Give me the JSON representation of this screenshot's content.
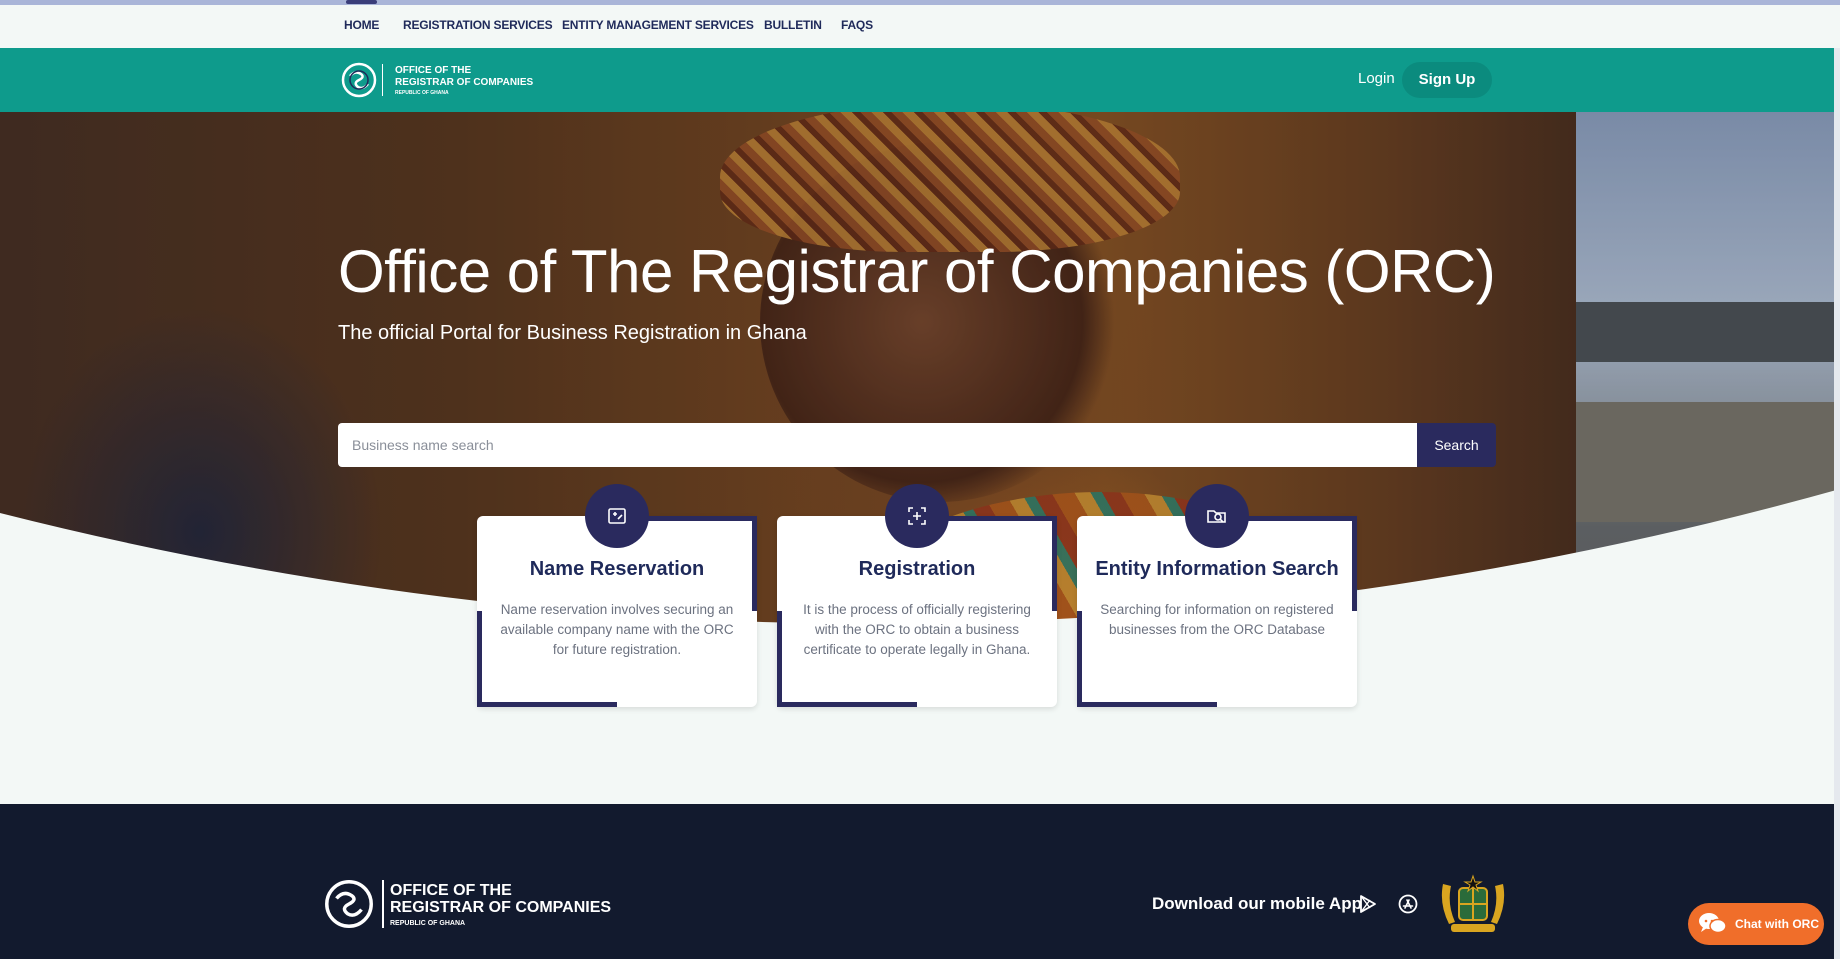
{
  "top_nav": {
    "items": [
      {
        "label": "HOME",
        "active": true
      },
      {
        "label": "REGISTRATION SERVICES"
      },
      {
        "label": "ENTITY MANAGEMENT SERVICES"
      },
      {
        "label": "BULLETIN"
      },
      {
        "label": "FAQS"
      }
    ]
  },
  "brand": {
    "line1": "OFFICE OF THE",
    "line2": "REGISTRAR OF COMPANIES",
    "line3": "REPUBLIC OF GHANA",
    "icon": "orc-logo-icon"
  },
  "auth": {
    "login_label": "Login",
    "signup_label": "Sign Up"
  },
  "hero": {
    "title": "Office of The Registrar of Companies (ORC)",
    "subtitle": "The official Portal for Business Registration in Ghana"
  },
  "search": {
    "placeholder": "Business name search",
    "button_label": "Search"
  },
  "cards": [
    {
      "title": "Name Reservation",
      "description": "Name reservation involves securing an available company name with the ORC for future registration.",
      "icon": "name-reservation-icon"
    },
    {
      "title": "Registration",
      "description": "It is the process of officially registering with the ORC to obtain a business certificate to operate legally in Ghana.",
      "icon": "registration-icon"
    },
    {
      "title": "Entity Information Search",
      "description": "Searching for information on registered businesses from the ORC Database",
      "icon": "entity-search-icon"
    }
  ],
  "footer": {
    "download_label": "Download our mobile App",
    "icons": [
      "google-play-icon",
      "app-store-icon",
      "coat-of-arms-icon"
    ]
  },
  "chat": {
    "label": "Chat with ORC",
    "icon": "chat-bubbles-icon"
  },
  "colors": {
    "brand_teal": "#0e9b8c",
    "navy": "#2a2a5e",
    "footer_bg": "#121a2e",
    "chat_orange": "#f06e2a"
  }
}
